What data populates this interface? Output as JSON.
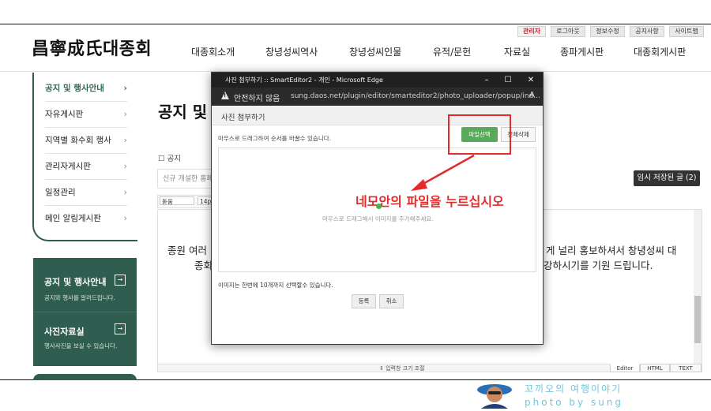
{
  "site": {
    "logo": "昌寧成氏대종회",
    "util_links": [
      "관리자",
      "로그아웃",
      "정보수정",
      "공지사항",
      "사이트맵"
    ],
    "nav": [
      "대종회소개",
      "창녕성씨역사",
      "창녕성씨인물",
      "유적/문헌",
      "자료실",
      "종파게시판",
      "대종회게시판"
    ]
  },
  "left_menu": {
    "items": [
      {
        "label": "공지 및 행사안내"
      },
      {
        "label": "자유게시판"
      },
      {
        "label": "지역별 화수회 행사"
      },
      {
        "label": "관리자게시판"
      },
      {
        "label": "일정관리"
      },
      {
        "label": "메인 알림게시판"
      }
    ],
    "chevron": "›"
  },
  "promo": [
    {
      "title": "공지 및 행사안내",
      "subtitle": "공지와 행사를 알려드립니다."
    },
    {
      "title": "사진자료실",
      "subtitle": "행사사진을 보실 수 있습니다."
    }
  ],
  "page": {
    "title": "공지 및 행사안내",
    "notice_checkbox": "☐ 공지",
    "title_placeholder": "신규 개설한 홈페이지",
    "temp_save": "임시 저장된 글 (2)",
    "font_select": "돋움",
    "size_select": "14pt",
    "body_line1_left": "종원 여러",
    "body_line1_right": "게 널리 홍보하셔서 창녕성씨 대",
    "body_line2_left": "종회",
    "body_line2_right": "강하시기를 기원 드립니다.",
    "resize_label": "⇕ 입력창 크기 조절",
    "modes": [
      "Editor",
      "HTML",
      "TEXT"
    ]
  },
  "popup": {
    "window_title": "사진 첨부하기 :: SmartEditor2 - 개인 - Microsoft Edge",
    "not_secure": "안전하지 않음",
    "url": "sung.daos.net/plugin/editor/smarteditor2/photo_uploader/popup/ind...",
    "header": "사진 첨부하기",
    "drag_hint": "마우스로 드래그하여 순서를 바꿀수 있습니다.",
    "file_select": "파일선택",
    "delete_all": "전체삭제",
    "drop_hint": "마우스로 드래그해서 이미지를 추가해주세요.",
    "limit_text": "이미지는 한번에 10개까지 선택할수 있습니다.",
    "register": "등록",
    "cancel": "취소",
    "controls": {
      "minimize": "–",
      "maximize": "☐",
      "close": "✕"
    }
  },
  "annotation": {
    "text": "네모안의 파일을 누르십시오",
    "color": "#e52a2a"
  },
  "watermark": {
    "line1": "꼬끼오의 여행이야기",
    "line2": "photo by sung"
  },
  "colors": {
    "brand_green": "#2f5d4f",
    "file_button_green": "#58a95a",
    "admin_red": "#c6262e",
    "watermark_blue": "#6ec6e0"
  }
}
